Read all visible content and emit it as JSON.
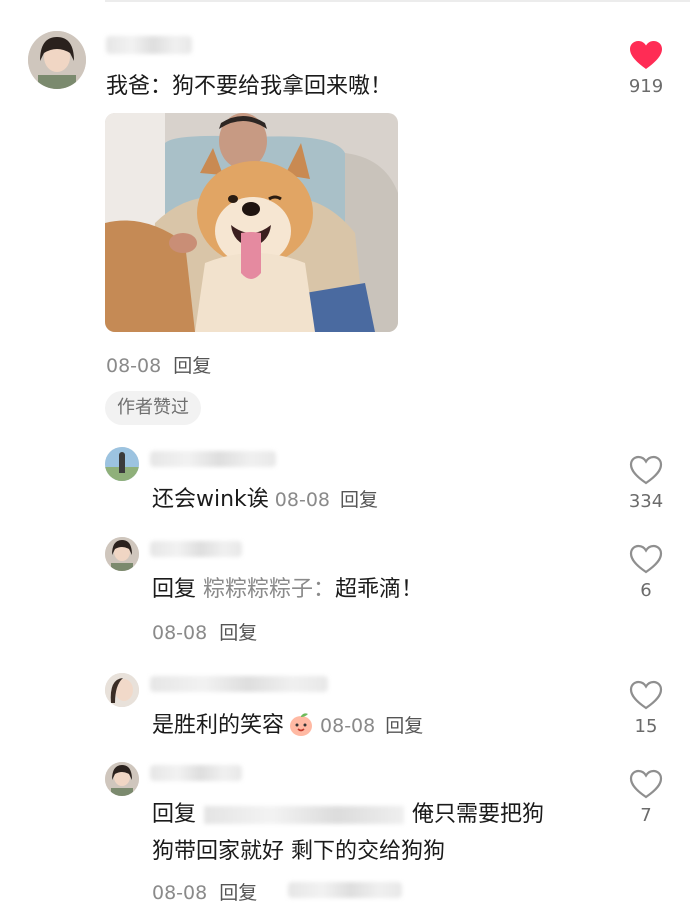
{
  "main_comment": {
    "text": "我爸：狗不要给我拿回来嗷！",
    "date": "08-08",
    "reply_label": "回复",
    "author_badge": "作者赞过",
    "likes": "919",
    "liked": true
  },
  "replies": [
    {
      "text": "还会wink诶",
      "date": "08-08",
      "reply_label": "回复",
      "likes": "334"
    },
    {
      "prefix": "回复",
      "target": "粽粽粽粽子：",
      "text": "超乖滴！",
      "date": "08-08",
      "reply_label": "回复",
      "likes": "6"
    },
    {
      "text": "是胜利的笑容",
      "emoji": "peach-face-emoji",
      "date": "08-08",
      "reply_label": "回复",
      "likes": "15"
    },
    {
      "prefix": "回复",
      "text_line1": "俺只需要把狗",
      "text_line2": "狗带回家就好 剩下的交给狗狗",
      "date": "08-08",
      "reply_label": "回复",
      "likes": "7"
    }
  ],
  "colors": {
    "like_active": "#ff2c55",
    "like_inactive": "#8f8f8f",
    "meta_grey": "#8a8a8a"
  }
}
